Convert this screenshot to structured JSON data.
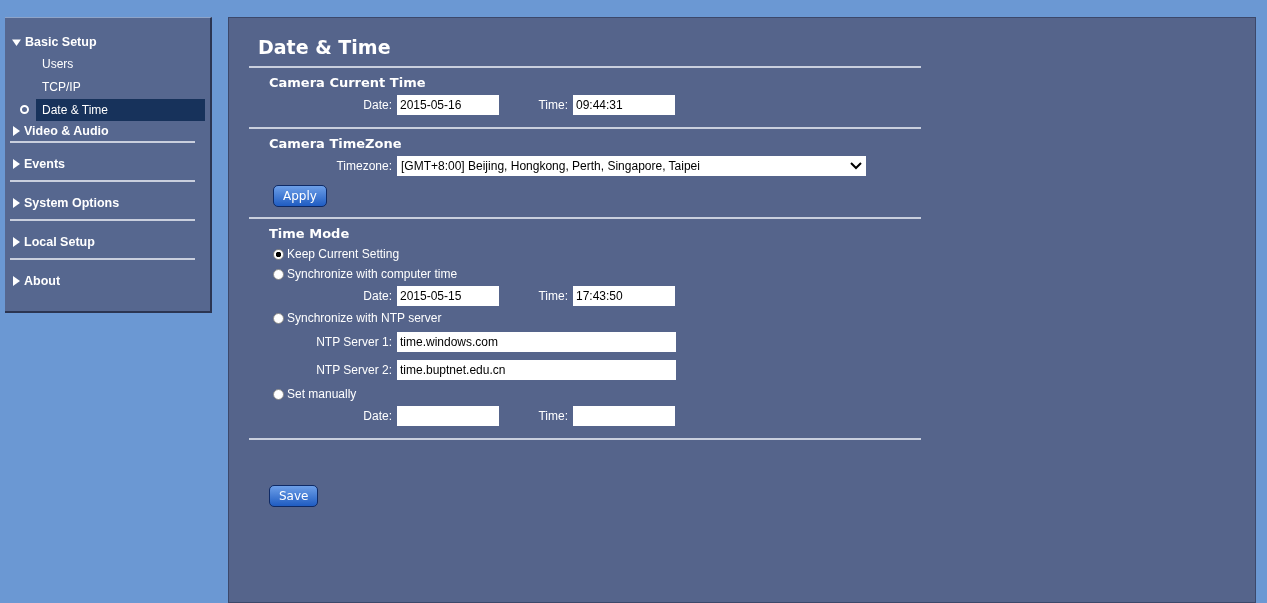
{
  "sidebar": {
    "groups": [
      {
        "label": "Basic Setup",
        "expanded": true,
        "items": [
          {
            "label": "Users",
            "selected": false
          },
          {
            "label": "TCP/IP",
            "selected": false
          },
          {
            "label": "Date & Time",
            "selected": true
          }
        ]
      },
      {
        "label": "Video & Audio",
        "expanded": false
      },
      {
        "label": "Events",
        "expanded": false
      },
      {
        "label": "System Options",
        "expanded": false
      },
      {
        "label": "Local Setup",
        "expanded": false
      },
      {
        "label": "About",
        "expanded": false
      }
    ]
  },
  "page": {
    "title": "Date & Time",
    "current_time": {
      "heading": "Camera Current Time",
      "fields": [
        {
          "label": "Date:",
          "value": "2015-05-16"
        },
        {
          "label": "Time:",
          "value": "09:44:31"
        }
      ]
    },
    "timezone": {
      "heading": "Camera TimeZone",
      "label": "Timezone:",
      "value": "[GMT+8:00] Beijing, Hongkong, Perth, Singapore, Taipei",
      "button": "Apply"
    },
    "time_mode": {
      "heading": "Time Mode",
      "options": [
        {
          "label": "Keep Current Setting",
          "selected": true,
          "kind": "plain"
        },
        {
          "label": "Synchronize with computer time",
          "selected": false,
          "kind": "pair",
          "fields": [
            {
              "label": "Date:",
              "value": "2015-05-15"
            },
            {
              "label": "Time:",
              "value": "17:43:50"
            }
          ]
        },
        {
          "label": "Synchronize with NTP server",
          "selected": false,
          "kind": "stack",
          "fields": [
            {
              "label": "NTP Server 1:",
              "value": "time.windows.com"
            },
            {
              "label": "NTP Server 2:",
              "value": "time.buptnet.edu.cn"
            }
          ]
        },
        {
          "label": "Set manually",
          "selected": false,
          "kind": "pair",
          "fields": [
            {
              "label": "Date:"
            },
            {
              "label": "Time:"
            }
          ]
        }
      ]
    },
    "save_button": "Save"
  }
}
